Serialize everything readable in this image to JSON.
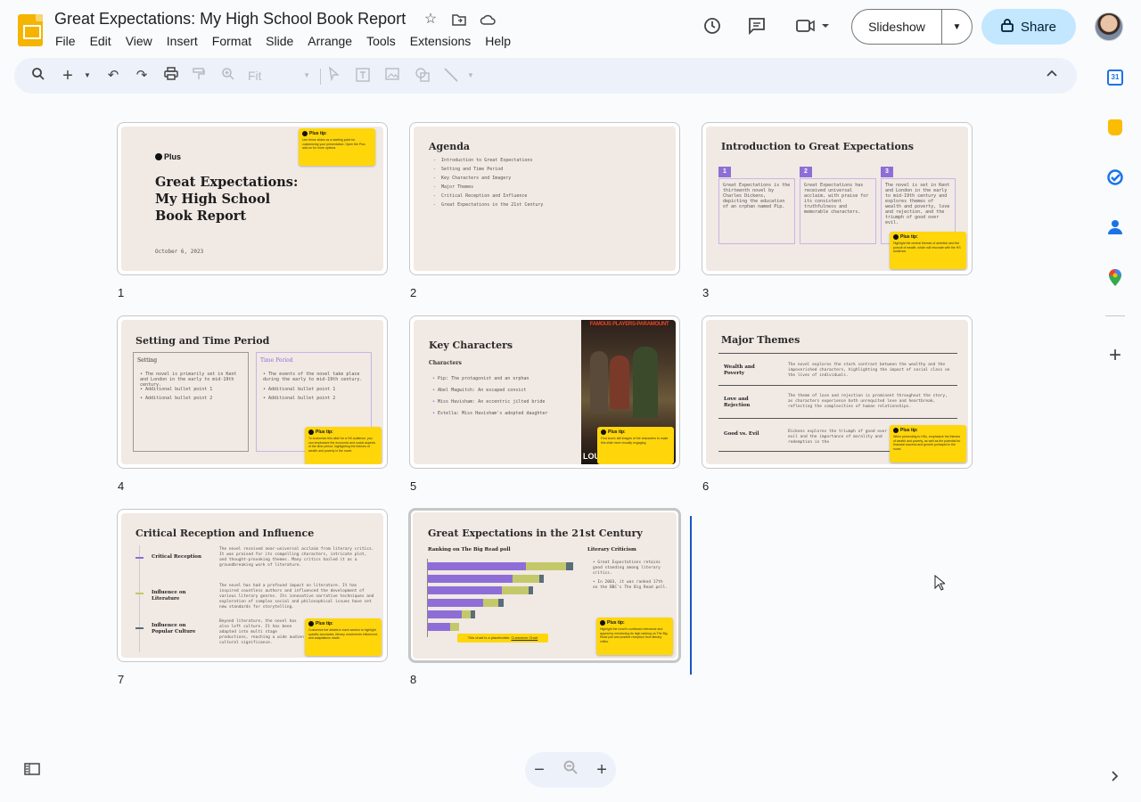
{
  "header": {
    "title": "Great Expectations: My High School Book Report",
    "menus": [
      "File",
      "Edit",
      "View",
      "Insert",
      "Format",
      "Slide",
      "Arrange",
      "Tools",
      "Extensions",
      "Help"
    ],
    "slideshow_label": "Slideshow",
    "share_label": "Share"
  },
  "toolbar": {
    "zoom_value": "Fit"
  },
  "slides": [
    {
      "num": "1",
      "brand": "Plus",
      "title": "Great Expectations: My High School Book Report",
      "date": "October 6, 2023",
      "tip_title": "Plus tip:",
      "tip_text": "Use these slides as a starting point for customizing your presentation. Open the Plus add-on for more options."
    },
    {
      "num": "2",
      "title": "Agenda",
      "items": [
        "Introduction to Great Expectations",
        "Setting and Time Period",
        "Key Characters and Imagery",
        "Major Themes",
        "Critical Reception and Influence",
        "Great Expectations in the 21st Century"
      ]
    },
    {
      "num": "3",
      "title": "Introduction to Great Expectations",
      "cols": [
        {
          "n": "1",
          "text": "Great Expectations is the thirteenth novel by Charles Dickens, depicting the education of an orphan named Pip."
        },
        {
          "n": "2",
          "text": "Great Expectations has received universal acclaim, with praise for its consistent truthfulness and memorable characters."
        },
        {
          "n": "3",
          "text": "The novel is set in Kent and London in the early to mid-19th century and explores themes of wealth and poverty, love and rejection, and the triumph of good over evil."
        }
      ],
      "tip_title": "Plus tip:",
      "tip_text": "Highlight the central themes of ambition and the pursuit of wealth, which will resonate with the HS audience."
    },
    {
      "num": "4",
      "title": "Setting and Time Period",
      "left_head": "Setting",
      "left_items": [
        "The novel is primarily set in Kent and London in the early to mid-19th century.",
        "Additional bullet point 1",
        "Additional bullet point 2"
      ],
      "right_head": "Time Period",
      "right_items": [
        "The events of the novel take place during the early to mid-19th century.",
        "Additional bullet point 1",
        "Additional bullet point 2"
      ],
      "tip_title": "Plus tip:",
      "tip_text": "To customize this slide for a HS audience, you can emphasize the economic and social aspects of the time period, highlighting the themes of wealth and poverty in the novel."
    },
    {
      "num": "5",
      "title": "Key Characters",
      "subhead": "Characters",
      "items": [
        "Pip: The protagonist and an orphan",
        "Abel Magwitch: An escaped convict",
        "Miss Havisham: An eccentric jilted bride",
        "Estella: Miss Havisham's adopted daughter"
      ],
      "poster_text": "FAMOUS PLAYERS-PARAMOUNT",
      "poster_bottom": "LOU",
      "tip_title": "Plus tip:",
      "tip_text": "Find iconic still images of the characters to make this slide more visually engaging."
    },
    {
      "num": "6",
      "title": "Major Themes",
      "rows": [
        {
          "label": "Wealth and Poverty",
          "text": "The novel explores the stark contrast between the wealthy and the impoverished characters, highlighting the impact of social class on the lives of individuals."
        },
        {
          "label": "Love and Rejection",
          "text": "The theme of love and rejection is prominent throughout the story, as characters experience both unrequited love and heartbreak, reflecting the complexities of human relationships."
        },
        {
          "label": "Good vs. Evil",
          "text": "Dickens explores the triumph of good over evil and the importance of morality and redemption in the"
        }
      ],
      "tip_title": "Plus tip:",
      "tip_text": "When presenting to HSs, emphasize the themes of wealth and poverty, as well as the potential for financial success and growth portrayed in the novel."
    },
    {
      "num": "7",
      "title": "Critical Reception and Influence",
      "rows": [
        {
          "label": "Critical Reception",
          "text": "The novel received near-universal acclaim from literary critics. It was praised for its compelling characters, intricate plot, and thought-provoking themes. Many critics hailed it as a groundbreaking work of literature."
        },
        {
          "label": "Influence on Literature",
          "text": "The novel has had a profound impact on literature. It has inspired countless authors and influenced the development of various literary genres. Its innovative narrative techniques and exploration of complex social and philosophical issues have set new standards for storytelling."
        },
        {
          "label": "Influence on Popular Culture",
          "text": "Beyond literature, the novel has also left culture. It has been adapted into multi stage productions, reaching a wide audien cultural significance."
        }
      ],
      "tip_title": "Plus tip:",
      "tip_text": "Customize the details in each section to highlight specific accolades, literary movements influenced, and adaptations made."
    },
    {
      "num": "8",
      "title": "Great Expectations in the 21st Century",
      "chart_head": "Ranking on The Big Read poll",
      "crit_head": "Literary Criticism",
      "crit_items": [
        "Great Expectations retains good standing among literary critics.",
        "In 2003, it was ranked 17th on the BBC's The Big Read poll."
      ],
      "placeholder_text": "This chart is a placeholder.",
      "placeholder_link": "Customize Chart",
      "tip_title": "Plus tip:",
      "tip_text": "Highlight the novel's continued relevance and appeal by mentioning its high ranking on The Big Read poll and positive reception from literary critics."
    }
  ],
  "chart_data": {
    "type": "bar",
    "orientation": "horizontal",
    "stacked": true,
    "categories": [
      "1",
      "2",
      "3",
      "4",
      "5",
      "6"
    ],
    "series": [
      {
        "values": [
          110,
          95,
          83,
          62,
          38,
          25
        ]
      },
      {
        "values": [
          45,
          30,
          30,
          17,
          10,
          10
        ]
      },
      {
        "values": [
          8,
          5,
          5,
          6,
          5,
          0
        ]
      }
    ],
    "colors": [
      "#8e6ed6",
      "#c3c96a",
      "#5a6d7a"
    ]
  },
  "colors": {
    "accent": "#8e6ed6",
    "tip": "#ffd60a",
    "share_bg": "#c2e7ff",
    "insert_cursor": "#1a56c4"
  }
}
